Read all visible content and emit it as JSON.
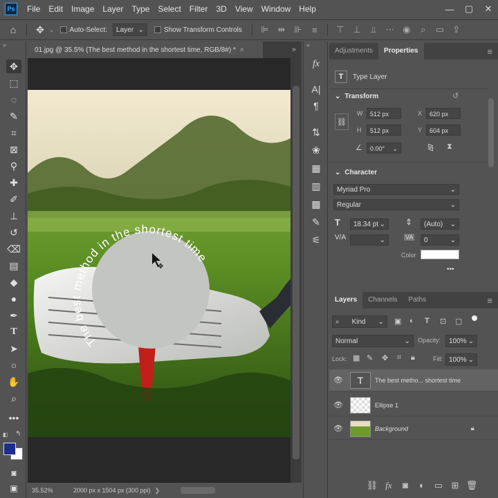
{
  "app": {
    "logo": "Ps"
  },
  "menu": [
    "File",
    "Edit",
    "Image",
    "Layer",
    "Type",
    "Select",
    "Filter",
    "3D",
    "View",
    "Window",
    "Help"
  ],
  "window_controls": [
    "—",
    "▢",
    "✕"
  ],
  "options": {
    "auto_select_label": "Auto-Select:",
    "auto_select_value": "Layer",
    "show_transform_label": "Show Transform Controls"
  },
  "document": {
    "tab_title": "01.jpg @ 35.5% (The best method in the shortest time, RGB/8#) *",
    "close": "×",
    "curved_text": "The best method in the shortest time"
  },
  "status": {
    "zoom": "35.52%",
    "doc_info": "2000 px x 1504 px (300 ppi)"
  },
  "properties": {
    "tabs": [
      "Adjustments",
      "Properties"
    ],
    "layer_type": "Type Layer",
    "transform": {
      "heading": "Transform",
      "w_label": "W",
      "w": "512 px",
      "h_label": "H",
      "h": "512 px",
      "x_label": "X",
      "x": "620 px",
      "y_label": "Y",
      "y": "604 px",
      "angle": "0.00°"
    },
    "character": {
      "heading": "Character",
      "font": "Myriad Pro",
      "style": "Regular",
      "size": "18.34 pt",
      "leading": "(Auto)",
      "kerning": "",
      "tracking": "0",
      "color_label": "Color",
      "text_color": "#ffffff"
    },
    "more": "•••"
  },
  "layers": {
    "tabs": [
      "Layers",
      "Channels",
      "Paths"
    ],
    "kind": "Kind",
    "blend": "Normal",
    "opacity_label": "Opacity:",
    "opacity": "100%",
    "lock_label": "Lock:",
    "fill_label": "Fill:",
    "fill": "100%",
    "items": [
      {
        "name": "The best metho... shortest time",
        "selected": true
      },
      {
        "name": "Ellipse 1",
        "selected": false
      },
      {
        "name": "Background",
        "selected": false
      }
    ]
  },
  "colors": {
    "accent": "#31a8ff",
    "foreground": "#1c2d8c",
    "background": "#ffffff",
    "ellipse": "#c3c5c0"
  }
}
